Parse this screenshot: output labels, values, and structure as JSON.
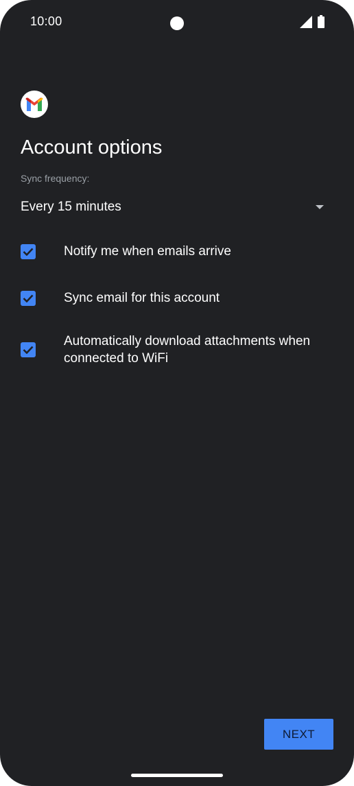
{
  "status_bar": {
    "time": "10:00",
    "icons": [
      "cellular-signal-icon",
      "battery-icon"
    ]
  },
  "app": {
    "logo_icon": "gmail-logo-icon",
    "title": "Account options"
  },
  "sync": {
    "label": "Sync frequency:",
    "selected": "Every 15 minutes"
  },
  "options": [
    {
      "label": "Notify me when emails arrive",
      "checked": true
    },
    {
      "label": "Sync email for this account",
      "checked": true
    },
    {
      "label": "Automatically download attachments when connected to WiFi",
      "checked": true
    }
  ],
  "actions": {
    "next_label": "NEXT"
  },
  "colors": {
    "background": "#202124",
    "accent": "#4285f4",
    "text": "#ffffff",
    "muted": "#9aa0a6"
  }
}
